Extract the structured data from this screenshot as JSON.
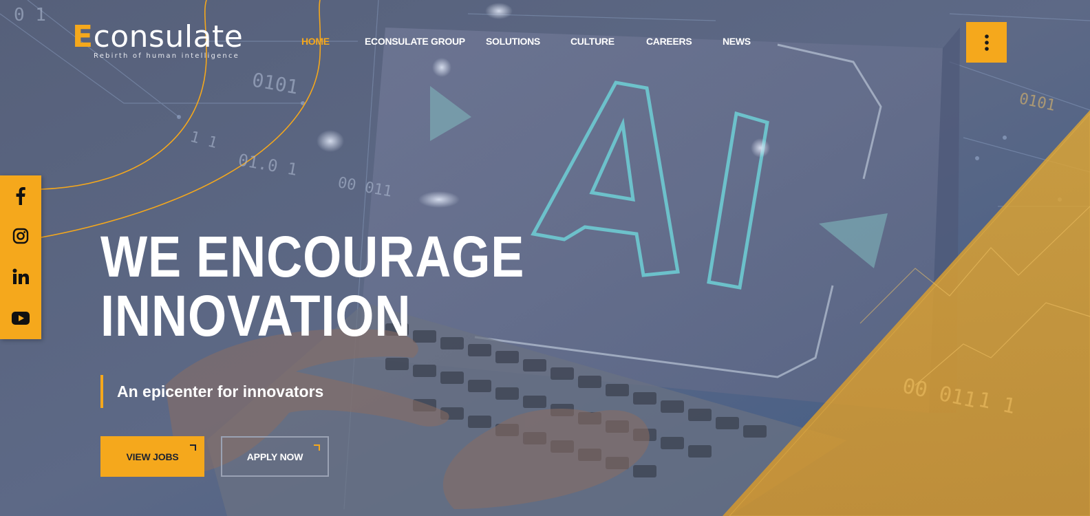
{
  "brand": {
    "logo_first_letter": "E",
    "logo_rest": "consulate",
    "tagline": "Rebirth of human intelligence",
    "accent_color": "#f5a81c"
  },
  "nav": {
    "items": [
      {
        "label": "HOME",
        "active": true
      },
      {
        "label": "ECONSULATE GROUP",
        "active": false
      },
      {
        "label": "SOLUTIONS",
        "active": false
      },
      {
        "label": "CULTURE",
        "active": false
      },
      {
        "label": "CAREERS",
        "active": false
      },
      {
        "label": "NEWS",
        "active": false
      }
    ],
    "menu_icon": "vertical-dots-icon"
  },
  "social": {
    "items": [
      {
        "name": "facebook",
        "icon": "facebook-icon"
      },
      {
        "name": "instagram",
        "icon": "instagram-icon"
      },
      {
        "name": "linkedin",
        "icon": "linkedin-icon"
      },
      {
        "name": "youtube",
        "icon": "youtube-icon"
      }
    ]
  },
  "hero": {
    "headline_line1": "WE ENCOURAGE",
    "headline_line2": "INNOVATION",
    "subline": "An epicenter for innovators",
    "primary_button": "VIEW JOBS",
    "secondary_button": "APPLY NOW",
    "screen_text": "AI",
    "binary_snippets": [
      "0 1",
      "0101",
      "1 1",
      "01.0 1",
      "00 011",
      "0101",
      "1 1",
      "00 011"
    ]
  }
}
